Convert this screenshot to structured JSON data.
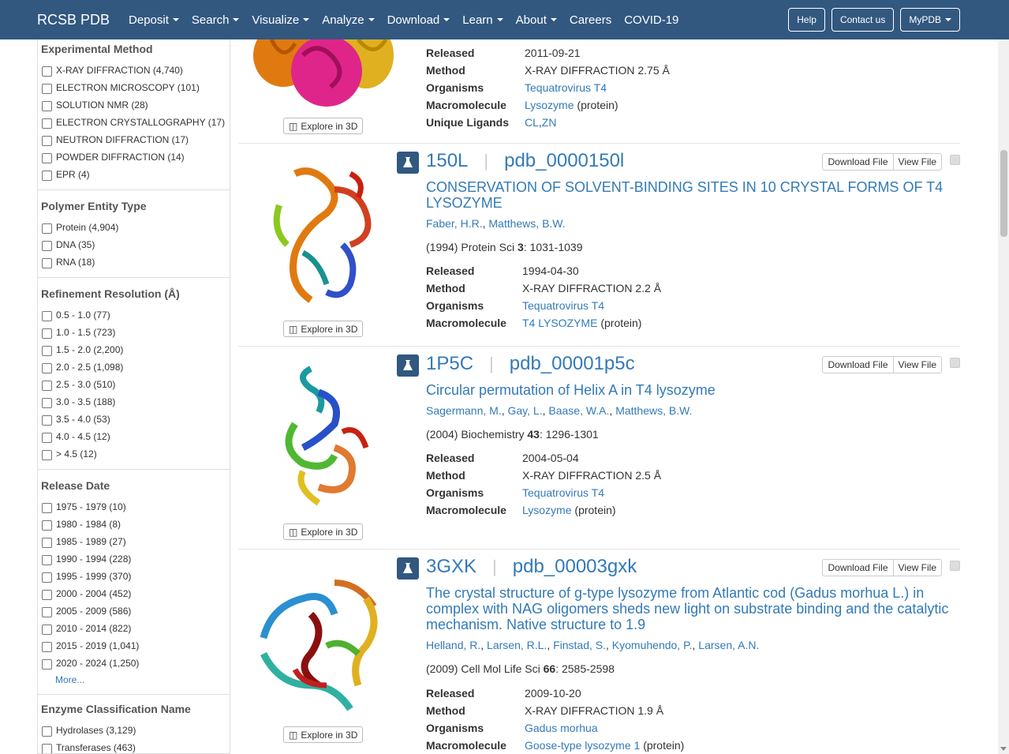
{
  "navbar": {
    "brand": "RCSB PDB",
    "items": [
      {
        "label": "Deposit",
        "dropdown": true
      },
      {
        "label": "Search",
        "dropdown": true
      },
      {
        "label": "Visualize",
        "dropdown": true
      },
      {
        "label": "Analyze",
        "dropdown": true
      },
      {
        "label": "Download",
        "dropdown": true
      },
      {
        "label": "Learn",
        "dropdown": true
      },
      {
        "label": "About",
        "dropdown": true
      },
      {
        "label": "Careers",
        "dropdown": false
      },
      {
        "label": "COVID-19",
        "dropdown": false
      }
    ],
    "help": "Help",
    "contact": "Contact us",
    "mypdb": "MyPDB"
  },
  "sidebar": {
    "facets": [
      {
        "title": "Experimental Method",
        "items": [
          "X-RAY DIFFRACTION (4,740)",
          "ELECTRON MICROSCOPY (101)",
          "SOLUTION NMR (28)",
          "ELECTRON CRYSTALLOGRAPHY (17)",
          "NEUTRON DIFFRACTION (17)",
          "POWDER DIFFRACTION (14)",
          "EPR (4)"
        ]
      },
      {
        "title": "Polymer Entity Type",
        "items": [
          "Protein (4,904)",
          "DNA (35)",
          "RNA (18)"
        ]
      },
      {
        "title": "Refinement Resolution (Å)",
        "items": [
          "0.5 - 1.0 (77)",
          "1.0 - 1.5 (723)",
          "1.5 - 2.0 (2,200)",
          "2.0 - 2.5 (1,098)",
          "2.5 - 3.0 (510)",
          "3.0 - 3.5 (188)",
          "3.5 - 4.0 (53)",
          "4.0 - 4.5 (12)",
          "> 4.5 (12)"
        ]
      },
      {
        "title": "Release Date",
        "items": [
          "1975 - 1979 (10)",
          "1980 - 1984 (8)",
          "1985 - 1989 (27)",
          "1990 - 1994 (228)",
          "1995 - 1999 (370)",
          "2000 - 2004 (452)",
          "2005 - 2009 (586)",
          "2010 - 2014 (822)",
          "2015 - 2019 (1,041)",
          "2020 - 2024 (1,250)"
        ],
        "more": "More..."
      },
      {
        "title": "Enzyme Classification Name",
        "items": [
          "Hydrolases (3,129)",
          "Transferases (463)"
        ]
      }
    ]
  },
  "labels": {
    "explore": "Explore in 3D",
    "download": "Download File",
    "view": "View File",
    "released": "Released",
    "method": "Method",
    "organisms": "Organisms",
    "macromolecule": "Macromolecule",
    "ligands": "Unique Ligands",
    "protein_suffix": "(protein)",
    "ligand_sep": ", "
  },
  "top_partial": {
    "released": "2011-09-21",
    "method": "X-RAY DIFFRACTION 2.75 Å",
    "organism": "Tequatrovirus T4",
    "macromolecule": "Lysozyme",
    "ligands": [
      "CL",
      "ZN"
    ]
  },
  "results": [
    {
      "id": "150L",
      "ext_id": "pdb_0000150l",
      "title": "CONSERVATION OF SOLVENT-BINDING SITES IN 10 CRYSTAL FORMS OF T4 LYSOZYME",
      "authors": [
        "Faber, H.R.",
        "Matthews, B.W."
      ],
      "citation": {
        "year_journal": "(1994) Protein Sci ",
        "volume": "3",
        "pages": ": 1031-1039"
      },
      "released": "1994-04-30",
      "method": "X-RAY DIFFRACTION 2.2 Å",
      "organism": "Tequatrovirus T4",
      "macromolecule": "T4 LYSOZYME"
    },
    {
      "id": "1P5C",
      "ext_id": "pdb_00001p5c",
      "title": "Circular permutation of Helix A in T4 lysozyme",
      "authors": [
        "Sagermann, M.",
        "Gay, L.",
        "Baase, W.A.",
        "Matthews, B.W."
      ],
      "citation": {
        "year_journal": "(2004) Biochemistry ",
        "volume": "43",
        "pages": ": 1296-1301"
      },
      "released": "2004-05-04",
      "method": "X-RAY DIFFRACTION 2.5 Å",
      "organism": "Tequatrovirus T4",
      "macromolecule": "Lysozyme"
    },
    {
      "id": "3GXK",
      "ext_id": "pdb_00003gxk",
      "title": "The crystal structure of g-type lysozyme from Atlantic cod (Gadus morhua L.) in complex with NAG oligomers sheds new light on substrate binding and the catalytic mechanism. Native structure to 1.9",
      "authors": [
        "Helland, R.",
        "Larsen, R.L.",
        "Finstad, S.",
        "Kyomuhendo, P.",
        "Larsen, A.N."
      ],
      "citation": {
        "year_journal": "(2009) Cell Mol Life Sci ",
        "volume": "66",
        "pages": ": 2585-2598"
      },
      "released": "2009-10-20",
      "method": "X-RAY DIFFRACTION 1.9 Å",
      "organism": "Gadus morhua",
      "macromolecule": "Goose-type lysozyme 1"
    }
  ]
}
